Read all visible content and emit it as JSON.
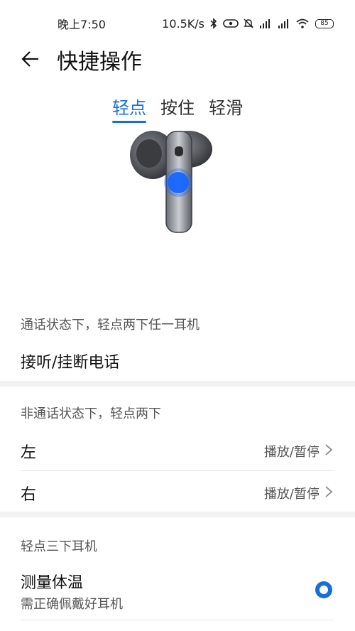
{
  "status_bar": {
    "time": "晚上7:50",
    "speed": "10.5K/s",
    "battery": "85",
    "icons": [
      "bluetooth-icon",
      "nfc-icon",
      "mute-bell-icon",
      "signal-hd-icon",
      "signal-hd-icon",
      "wifi-icon",
      "battery-icon"
    ]
  },
  "header": {
    "title": "快捷操作",
    "back_icon": "arrow-left-icon"
  },
  "tabs": [
    {
      "label": "轻点",
      "active": true
    },
    {
      "label": "按住",
      "active": false
    },
    {
      "label": "轻滑",
      "active": false
    }
  ],
  "accent": "#1a6fd6",
  "sections": {
    "call": {
      "label": "通话状态下，轻点两下任一耳机",
      "action": "接听/挂断电话"
    },
    "non_call": {
      "label": "非通话状态下，轻点两下",
      "rows": [
        {
          "title": "左",
          "value": "播放/暂停"
        },
        {
          "title": "右",
          "value": "播放/暂停"
        }
      ]
    },
    "triple": {
      "label": "轻点三下耳机",
      "item": {
        "title": "测量体温",
        "subtitle": "需正确佩戴好耳机",
        "selected": true
      }
    }
  }
}
